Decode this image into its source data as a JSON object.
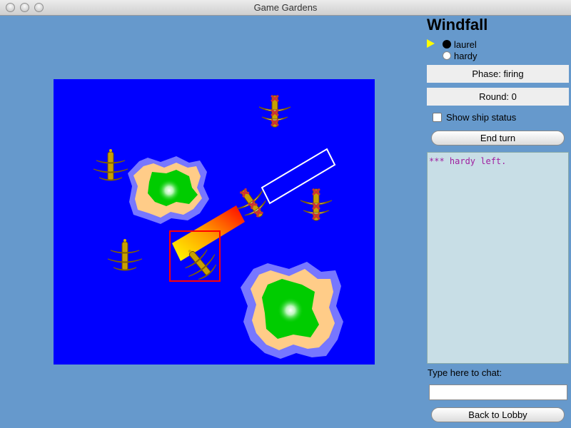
{
  "window": {
    "title": "Game Gardens"
  },
  "game": {
    "title": "Windfall",
    "players": [
      {
        "name": "laurel",
        "marker": "black",
        "has_turn": true
      },
      {
        "name": "hardy",
        "marker": "white",
        "has_turn": false
      }
    ],
    "phase_text": "Phase:  firing",
    "round_text": "Round:  0",
    "show_status_label": "Show ship status",
    "show_status_checked": false,
    "end_turn_label": "End turn"
  },
  "chat": {
    "messages": [
      "*** hardy left."
    ],
    "prompt": "Type here to chat:",
    "input_value": "",
    "back_label": "Back to Lobby"
  },
  "colors": {
    "sea": "#0000ff",
    "panel_bg": "#6699cc",
    "chat_text": "#a020a0",
    "turn_arrow": "#ffff00",
    "selection": "#ff0000",
    "enemy_sail": "#cc3333",
    "own_sail": "#d4b000"
  }
}
